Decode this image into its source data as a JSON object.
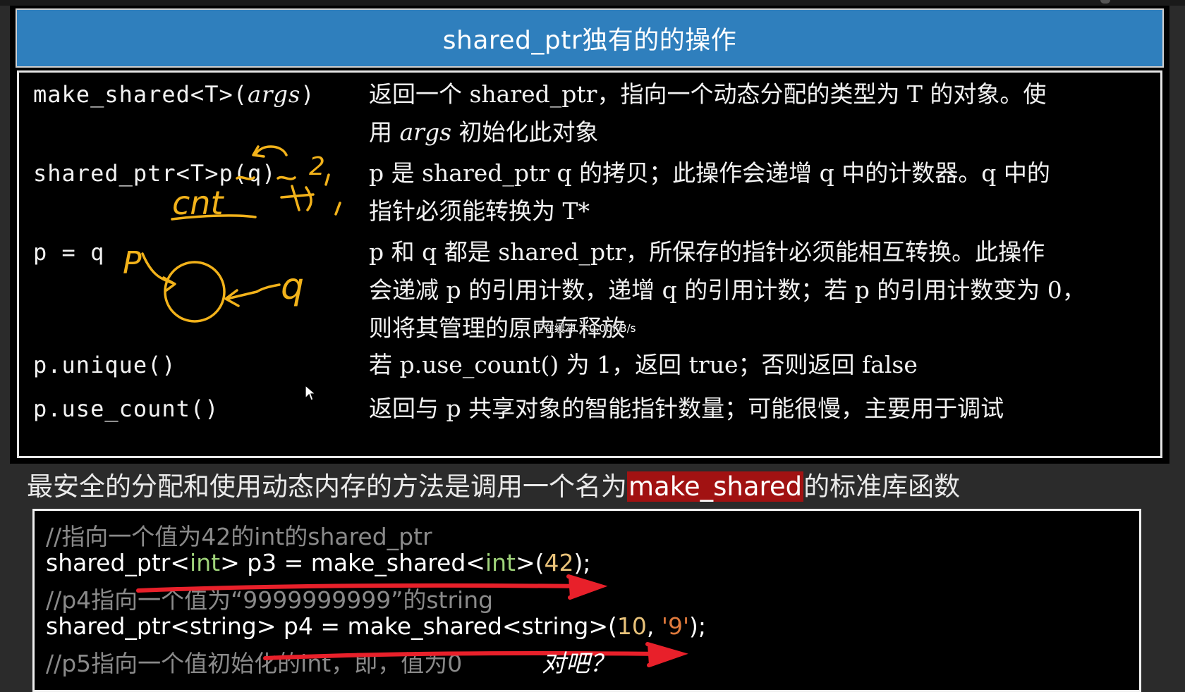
{
  "slide": {
    "title": "shared_ptr独有的的操作",
    "rows": [
      {
        "op": "make_shared<T>(args)",
        "op_parts": {
          "pre": "make_shared<T>(",
          "arg": "args",
          "post": ")"
        },
        "desc_parts": [
          "返回一个 shared_ptr，指向一个动态分配的类型为 T 的对象。使",
          "用 ",
          "args",
          " 初始化此对象"
        ]
      },
      {
        "op": "shared_ptr<T>p(q)",
        "desc_lines": [
          "p 是 shared_ptr q 的拷贝；此操作会递增 q 中的计数器。q 中的",
          "指针必须能转换为 T*"
        ]
      },
      {
        "op": "p = q",
        "desc_lines": [
          "p 和 q 都是 shared_ptr，所保存的指针必须能相互转换。此操作",
          "会递减 p 的引用计数，递增 q 的引用计数；若 p 的引用计数变为 0，",
          "则将其管理的原内存释放"
        ]
      },
      {
        "op": "p.unique()",
        "desc_lines": [
          "若 p.use_count() 为 1，返回 true；否则返回 false"
        ]
      },
      {
        "op": "p.use_count()",
        "desc_lines": [
          "返回与 p 共享对象的智能指针数量；可能很慢，主要用于调试"
        ]
      }
    ]
  },
  "handwriting": {
    "cnt": "cnt",
    "two": "2",
    "p_letter": "P",
    "q_letter": "q",
    "note": "对吧？",
    "ink_color": "#f2b21a",
    "arrow_color": "#e8202a"
  },
  "overlay": {
    "buffering": "正在缓冲... 0.00KB/s"
  },
  "caption": {
    "before": "最安全的分配和使用动态内存的方法是调用一个名为",
    "highlight": "make_shared",
    "after": "的标准库函数",
    "highlight_color": "#a11212"
  },
  "code": {
    "line1": "//指向一个值为42的int的shared_ptr",
    "line2": {
      "a": "shared_ptr<",
      "b": "int",
      "c": "> p3 = make_shared<",
      "d": "int",
      "e": ">(",
      "f": "42",
      "g": ");"
    },
    "line3": "//p4指向一个值为“9999999999”的string",
    "line4": {
      "a": "shared_ptr<string> p4 = make_shared<string>(",
      "b": "10",
      "c": ", ",
      "d": "'9'",
      "e": ");"
    },
    "line5": "//p5指向一个值初始化的int，即，值为0"
  }
}
